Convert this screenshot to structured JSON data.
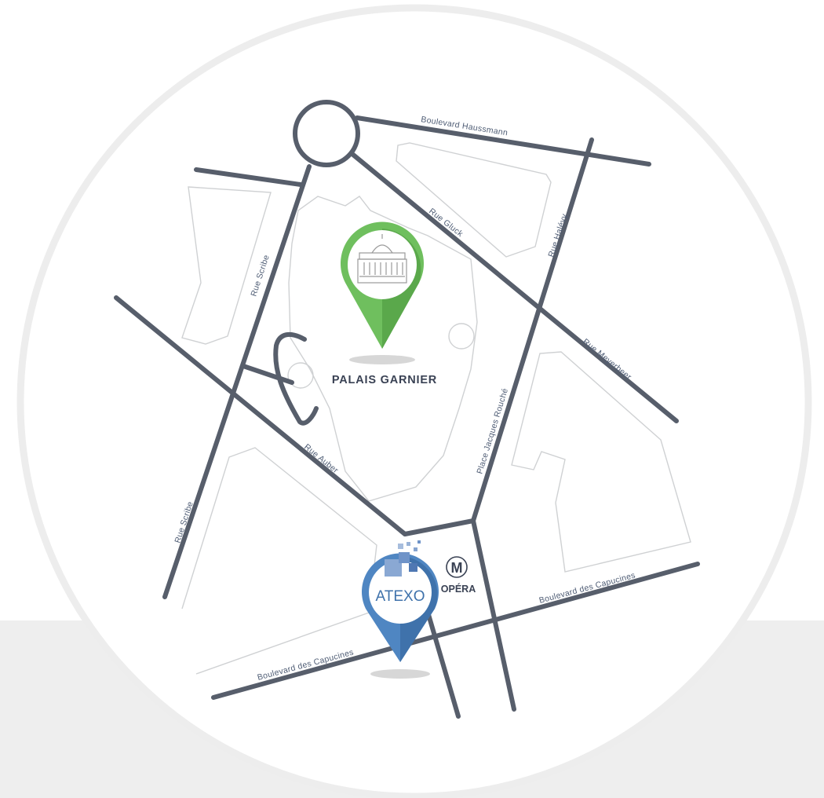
{
  "colors": {
    "road": "#575e6b",
    "building_outline": "#cfd1d3",
    "circle_border": "#ededed",
    "lower_band": "#eeeeee",
    "garnier_pin": "#6fbf5e",
    "atexo_pin": "#4f86c2",
    "label": "#4f5d75"
  },
  "streets": {
    "haussmann": "Boulevard Haussmann",
    "gluck": "Rue Gluck",
    "halevy": "Rue Halévy",
    "meyerbeer": "Rue Meyerbeer",
    "scribe_top": "Rue Scribe",
    "scribe_bottom": "Rue Scribe",
    "auber": "Rue Auber",
    "rouche": "Place Jacques Rouché",
    "capucines_right": "Boulevard des Capucines",
    "capucines_left": "Boulevard des Capucines"
  },
  "landmarks": {
    "garnier": {
      "label": "PALAIS GARNIER",
      "icon": "opera-house-icon"
    },
    "atexo": {
      "label": "ATEXO",
      "icon": "map-pin-icon"
    },
    "metro": {
      "symbol": "M",
      "label": "OPÉRA",
      "icon": "metro-icon"
    }
  }
}
